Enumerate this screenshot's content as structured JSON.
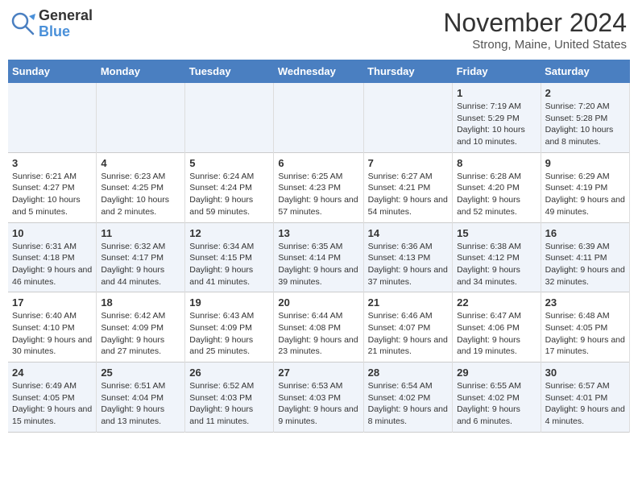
{
  "header": {
    "logo_general": "General",
    "logo_blue": "Blue",
    "month": "November 2024",
    "location": "Strong, Maine, United States"
  },
  "weekdays": [
    "Sunday",
    "Monday",
    "Tuesday",
    "Wednesday",
    "Thursday",
    "Friday",
    "Saturday"
  ],
  "weeks": [
    [
      {
        "day": "",
        "info": ""
      },
      {
        "day": "",
        "info": ""
      },
      {
        "day": "",
        "info": ""
      },
      {
        "day": "",
        "info": ""
      },
      {
        "day": "",
        "info": ""
      },
      {
        "day": "1",
        "info": "Sunrise: 7:19 AM\nSunset: 5:29 PM\nDaylight: 10 hours and 10 minutes."
      },
      {
        "day": "2",
        "info": "Sunrise: 7:20 AM\nSunset: 5:28 PM\nDaylight: 10 hours and 8 minutes."
      }
    ],
    [
      {
        "day": "3",
        "info": "Sunrise: 6:21 AM\nSunset: 4:27 PM\nDaylight: 10 hours and 5 minutes."
      },
      {
        "day": "4",
        "info": "Sunrise: 6:23 AM\nSunset: 4:25 PM\nDaylight: 10 hours and 2 minutes."
      },
      {
        "day": "5",
        "info": "Sunrise: 6:24 AM\nSunset: 4:24 PM\nDaylight: 9 hours and 59 minutes."
      },
      {
        "day": "6",
        "info": "Sunrise: 6:25 AM\nSunset: 4:23 PM\nDaylight: 9 hours and 57 minutes."
      },
      {
        "day": "7",
        "info": "Sunrise: 6:27 AM\nSunset: 4:21 PM\nDaylight: 9 hours and 54 minutes."
      },
      {
        "day": "8",
        "info": "Sunrise: 6:28 AM\nSunset: 4:20 PM\nDaylight: 9 hours and 52 minutes."
      },
      {
        "day": "9",
        "info": "Sunrise: 6:29 AM\nSunset: 4:19 PM\nDaylight: 9 hours and 49 minutes."
      }
    ],
    [
      {
        "day": "10",
        "info": "Sunrise: 6:31 AM\nSunset: 4:18 PM\nDaylight: 9 hours and 46 minutes."
      },
      {
        "day": "11",
        "info": "Sunrise: 6:32 AM\nSunset: 4:17 PM\nDaylight: 9 hours and 44 minutes."
      },
      {
        "day": "12",
        "info": "Sunrise: 6:34 AM\nSunset: 4:15 PM\nDaylight: 9 hours and 41 minutes."
      },
      {
        "day": "13",
        "info": "Sunrise: 6:35 AM\nSunset: 4:14 PM\nDaylight: 9 hours and 39 minutes."
      },
      {
        "day": "14",
        "info": "Sunrise: 6:36 AM\nSunset: 4:13 PM\nDaylight: 9 hours and 37 minutes."
      },
      {
        "day": "15",
        "info": "Sunrise: 6:38 AM\nSunset: 4:12 PM\nDaylight: 9 hours and 34 minutes."
      },
      {
        "day": "16",
        "info": "Sunrise: 6:39 AM\nSunset: 4:11 PM\nDaylight: 9 hours and 32 minutes."
      }
    ],
    [
      {
        "day": "17",
        "info": "Sunrise: 6:40 AM\nSunset: 4:10 PM\nDaylight: 9 hours and 30 minutes."
      },
      {
        "day": "18",
        "info": "Sunrise: 6:42 AM\nSunset: 4:09 PM\nDaylight: 9 hours and 27 minutes."
      },
      {
        "day": "19",
        "info": "Sunrise: 6:43 AM\nSunset: 4:09 PM\nDaylight: 9 hours and 25 minutes."
      },
      {
        "day": "20",
        "info": "Sunrise: 6:44 AM\nSunset: 4:08 PM\nDaylight: 9 hours and 23 minutes."
      },
      {
        "day": "21",
        "info": "Sunrise: 6:46 AM\nSunset: 4:07 PM\nDaylight: 9 hours and 21 minutes."
      },
      {
        "day": "22",
        "info": "Sunrise: 6:47 AM\nSunset: 4:06 PM\nDaylight: 9 hours and 19 minutes."
      },
      {
        "day": "23",
        "info": "Sunrise: 6:48 AM\nSunset: 4:05 PM\nDaylight: 9 hours and 17 minutes."
      }
    ],
    [
      {
        "day": "24",
        "info": "Sunrise: 6:49 AM\nSunset: 4:05 PM\nDaylight: 9 hours and 15 minutes."
      },
      {
        "day": "25",
        "info": "Sunrise: 6:51 AM\nSunset: 4:04 PM\nDaylight: 9 hours and 13 minutes."
      },
      {
        "day": "26",
        "info": "Sunrise: 6:52 AM\nSunset: 4:03 PM\nDaylight: 9 hours and 11 minutes."
      },
      {
        "day": "27",
        "info": "Sunrise: 6:53 AM\nSunset: 4:03 PM\nDaylight: 9 hours and 9 minutes."
      },
      {
        "day": "28",
        "info": "Sunrise: 6:54 AM\nSunset: 4:02 PM\nDaylight: 9 hours and 8 minutes."
      },
      {
        "day": "29",
        "info": "Sunrise: 6:55 AM\nSunset: 4:02 PM\nDaylight: 9 hours and 6 minutes."
      },
      {
        "day": "30",
        "info": "Sunrise: 6:57 AM\nSunset: 4:01 PM\nDaylight: 9 hours and 4 minutes."
      }
    ]
  ]
}
